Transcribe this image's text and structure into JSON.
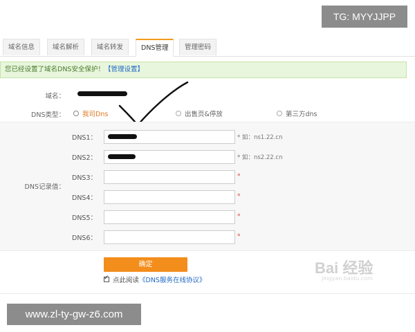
{
  "overlays": {
    "tg_badge": "TG: MYYJJPP",
    "url_badge": "www.zl-ty-gw-z6.com",
    "watermark": "Bai 经验",
    "watermark_sub": "jingyan.baidu.com"
  },
  "tabs": [
    {
      "label": "域名信息",
      "active": false
    },
    {
      "label": "域名解析",
      "active": false
    },
    {
      "label": "域名转发",
      "active": false
    },
    {
      "label": "DNS管理",
      "active": true
    },
    {
      "label": "管理密码",
      "active": false
    }
  ],
  "notice": {
    "text": "您已经设置了域名DNS安全保护！",
    "link": "【管理设置】"
  },
  "form": {
    "domain_label": "域名：",
    "dns_type_label": "DNS类型：",
    "dns_type_options": [
      "我司Dns",
      "出售页&停放",
      "第三方dns"
    ],
    "dns_type_selected": "我司Dns",
    "dns_records_label": "DNS记录值：",
    "dns_fields": [
      {
        "label": "DNS1：",
        "hint": "* 如：ns1.22.cn"
      },
      {
        "label": "DNS2：",
        "hint": "* 如：ns2.22.cn"
      },
      {
        "label": "DNS3：",
        "hint": "*"
      },
      {
        "label": "DNS4：",
        "hint": "*"
      },
      {
        "label": "DNS5：",
        "hint": "*"
      },
      {
        "label": "DNS6：",
        "hint": "*"
      }
    ],
    "confirm_label": "确定",
    "agree_prefix": "点此阅读",
    "agree_link": "《DNS服务在线协议》",
    "agree_checked": true
  }
}
